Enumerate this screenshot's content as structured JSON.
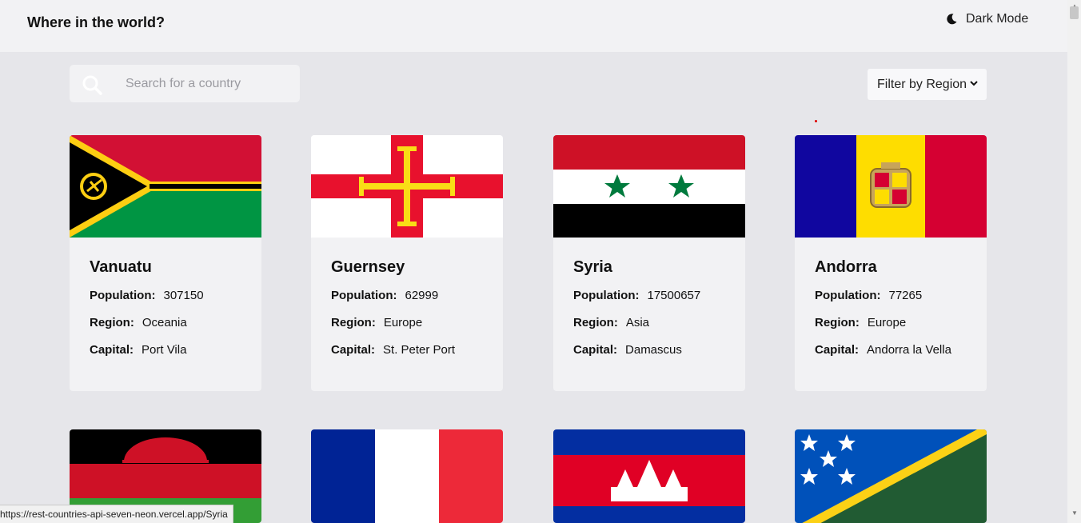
{
  "header": {
    "title": "Where in the world?",
    "dark_mode_label": "Dark Mode",
    "dark_mode_icon": "moon-icon"
  },
  "search": {
    "placeholder": "Search for a country",
    "value": "",
    "icon": "search-icon"
  },
  "filter": {
    "label": "Filter by Region",
    "icon": "chevron-down-icon"
  },
  "labels": {
    "population": "Population:",
    "region": "Region:",
    "capital": "Capital:"
  },
  "countries": [
    {
      "name": "Vanuatu",
      "population": "307150",
      "region": "Oceania",
      "capital": "Port Vila"
    },
    {
      "name": "Guernsey",
      "population": "62999",
      "region": "Europe",
      "capital": "St. Peter Port"
    },
    {
      "name": "Syria",
      "population": "17500657",
      "region": "Asia",
      "capital": "Damascus"
    },
    {
      "name": "Andorra",
      "population": "77265",
      "region": "Europe",
      "capital": "Andorra la Vella"
    }
  ],
  "status_bar": {
    "url": "https://rest-countries-api-seven-neon.vercel.app/Syria"
  },
  "colors": {
    "background": "#e6e6ea",
    "surface": "#f2f2f4",
    "text": "#111111"
  }
}
